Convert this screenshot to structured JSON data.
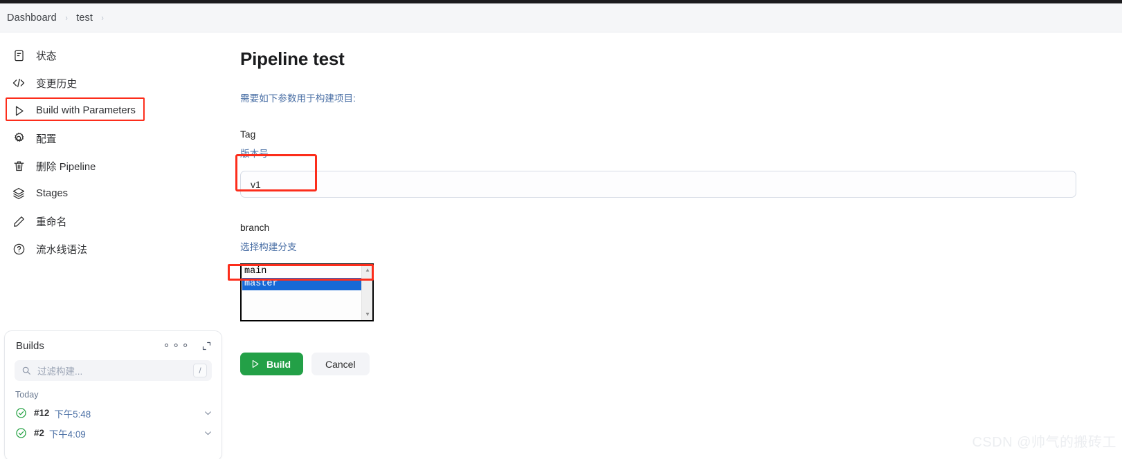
{
  "breadcrumb": {
    "items": [
      "Dashboard",
      "test"
    ],
    "separator": "›"
  },
  "sidebar": {
    "items": [
      {
        "label": "状态",
        "icon": "document-icon",
        "highlighted": false
      },
      {
        "label": "变更历史",
        "icon": "code-icon",
        "highlighted": false
      },
      {
        "label": "Build with Parameters",
        "icon": "play-icon",
        "highlighted": true
      },
      {
        "label": "配置",
        "icon": "gear-icon",
        "highlighted": false
      },
      {
        "label": "删除 Pipeline",
        "icon": "trash-icon",
        "highlighted": false
      },
      {
        "label": "Stages",
        "icon": "layers-icon",
        "highlighted": false
      },
      {
        "label": "重命名",
        "icon": "pencil-icon",
        "highlighted": false
      },
      {
        "label": "流水线语法",
        "icon": "question-icon",
        "highlighted": false
      }
    ]
  },
  "builds_panel": {
    "title": "Builds",
    "more_icon": "ellipsis-icon",
    "expand_icon": "expand-icon",
    "filter": {
      "icon": "search-icon",
      "placeholder": "过滤构建...",
      "shortcut_key": "/"
    },
    "group_label": "Today",
    "rows": [
      {
        "status_icon": "check-circle-icon",
        "number": "#12",
        "time": "下午5:48",
        "chevron": "chevron-down-icon"
      },
      {
        "status_icon": "check-circle-icon",
        "number": "#2",
        "time": "下午4:09",
        "chevron": "chevron-down-icon"
      }
    ]
  },
  "main": {
    "title": "Pipeline test",
    "intro": "需要如下参数用于构建项目:",
    "params": [
      {
        "name": "Tag",
        "description": "版本号",
        "type": "text",
        "value": "v1"
      },
      {
        "name": "branch",
        "description": "选择构建分支",
        "type": "listbox",
        "options": [
          "main",
          "master"
        ],
        "selected": "master"
      }
    ],
    "buttons": {
      "build_label": "Build",
      "build_icon": "play-icon",
      "cancel_label": "Cancel"
    }
  },
  "watermark": "CSDN @帅气的搬砖工",
  "colors": {
    "accent_green": "#23a047",
    "link_blue": "#4a6fa5",
    "highlight_red": "#fc2d1b",
    "selection_blue": "#1669d6",
    "header_bg": "#f5f6f8"
  }
}
